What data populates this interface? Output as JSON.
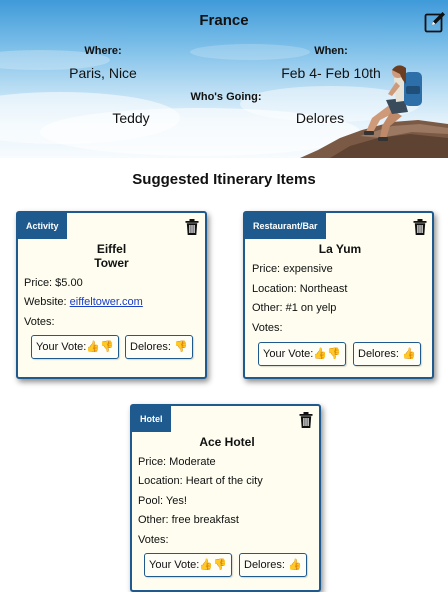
{
  "trip": {
    "title": "France",
    "where_label": "Where:",
    "where_value": "Paris, Nice",
    "when_label": "When:",
    "when_value": "Feb 4- Feb 10th",
    "going_label": "Who's Going:",
    "travelers": [
      "Teddy",
      "Delores"
    ],
    "edit_icon": "edit-pencil-icon"
  },
  "itinerary": {
    "title": "Suggested Itinerary Items",
    "cards": [
      {
        "tag": "Activity",
        "name_line1": "Eiffel",
        "name_line2": "Tower",
        "rows": [
          "Price: $5.00"
        ],
        "website_label": "Website: ",
        "website_link": "eiffeltower.com",
        "votes_label": "Votes:",
        "your_vote": "Your Vote:👍👎",
        "other_vote": "Delores: 👎"
      },
      {
        "tag": "Restaurant/Bar",
        "name": "La Yum",
        "rows": [
          "Price: expensive",
          "Location: Northeast",
          "Other: #1 on yelp"
        ],
        "votes_label": "Votes:",
        "your_vote": "Your Vote:👍👎",
        "other_vote": "Delores: 👍"
      },
      {
        "tag": "Hotel",
        "name": "Ace Hotel",
        "rows": [
          "Price: Moderate",
          "Location: Heart of the city",
          "Pool: Yes!",
          "Other: free breakfast"
        ],
        "votes_label": "Votes:",
        "your_vote": "Your Vote:👍👎",
        "other_vote": "Delores: 👍"
      }
    ]
  },
  "colors": {
    "accent": "#1f5a8e",
    "card_bg": "#fefdf0",
    "link": "#1a3ec6"
  }
}
